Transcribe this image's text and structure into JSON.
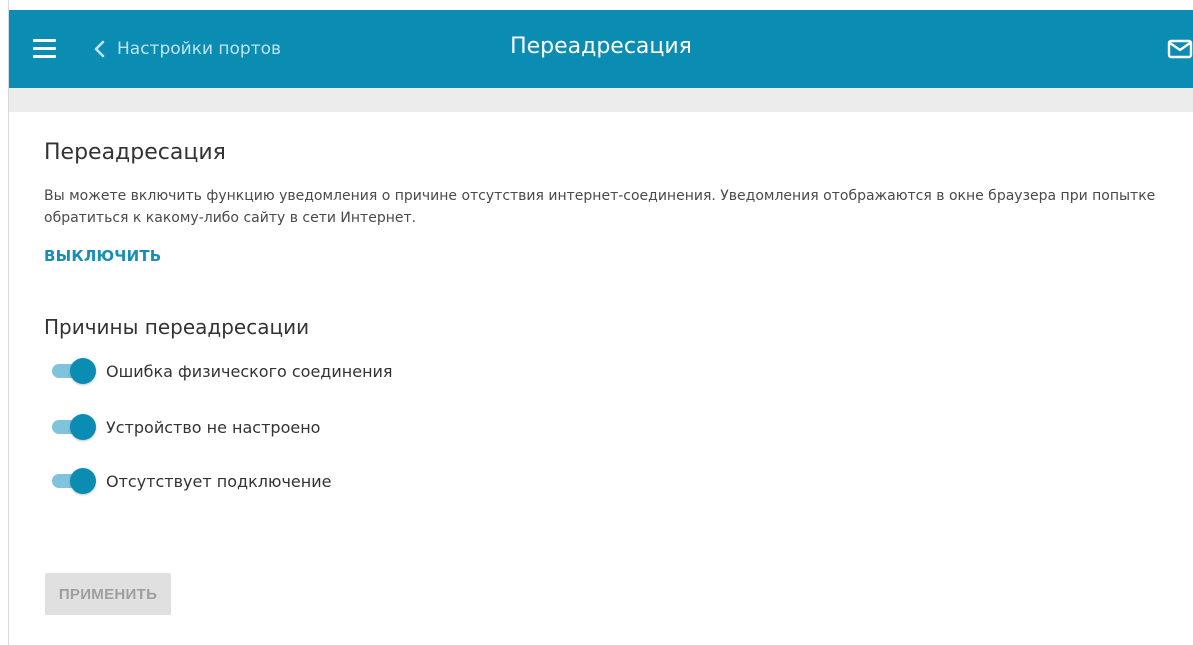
{
  "header": {
    "back_label": "Настройки портов",
    "title": "Переадресация",
    "background_color": "#0b8cb3"
  },
  "icons": {
    "menu": "hamburger-icon",
    "back": "chevron-left-icon",
    "mail": "envelope-icon"
  },
  "section": {
    "title": "Переадресация",
    "description": "Вы можете включить функцию уведомления о причине отсутствия интернет-соединения. Уведомления отображаются в окне браузера при попытке обратиться к какому-либо сайту в сети Интернет.",
    "disable_link": "ВЫКЛЮЧИТЬ"
  },
  "reasons": {
    "title": "Причины переадресации",
    "items": [
      {
        "label": "Ошибка физического соединения",
        "enabled": true
      },
      {
        "label": "Устройство не настроено",
        "enabled": true
      },
      {
        "label": "Отсутствует подключение",
        "enabled": true
      }
    ]
  },
  "apply_button": {
    "label": "ПРИМЕНИТЬ",
    "disabled": true
  }
}
